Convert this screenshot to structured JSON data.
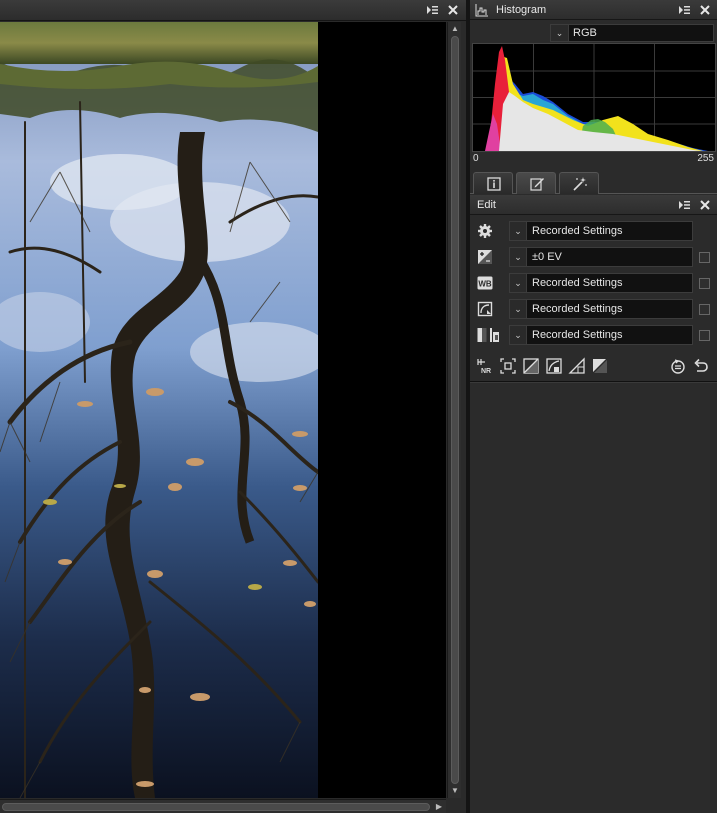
{
  "viewer": {
    "titlebar_icons": [
      "panel-menu-icon",
      "close-icon"
    ]
  },
  "histogram_panel": {
    "title": "Histogram",
    "channel_select": {
      "value": "RGB"
    },
    "axis": {
      "min": "0",
      "max": "255"
    }
  },
  "tabs": [
    {
      "icon": "info-icon",
      "active": false
    },
    {
      "icon": "edit-pencil-icon",
      "active": true
    },
    {
      "icon": "magic-wand-icon",
      "active": false
    }
  ],
  "edit_panel": {
    "title": "Edit",
    "rows": [
      {
        "icon": "gear-icon",
        "value": "Recorded Settings",
        "has_checkbox": false
      },
      {
        "icon": "exposure-icon",
        "value": "±0 EV",
        "has_checkbox": true
      },
      {
        "icon": "wb-icon",
        "icon_text": "WB",
        "value": "Recorded Settings",
        "has_checkbox": true
      },
      {
        "icon": "picture-control-icon",
        "value": "Recorded Settings",
        "has_checkbox": true
      },
      {
        "icon": "active-d-lighting-icon",
        "value": "Recorded Settings",
        "has_checkbox": true
      }
    ],
    "tools": [
      {
        "icon": "noise-reduction-icon",
        "text": "NR"
      },
      {
        "icon": "crop-icon"
      },
      {
        "icon": "levels-curves-icon"
      },
      {
        "icon": "color-adjust-icon"
      },
      {
        "icon": "straighten-icon"
      },
      {
        "icon": "tone-icon"
      },
      {
        "icon": "history-icon"
      },
      {
        "icon": "undo-icon"
      }
    ]
  },
  "colors": {
    "panel_bg": "#2b2b2b",
    "header_bg": "#333333",
    "field_bg": "#111111",
    "histogram_red": "#e8203a",
    "histogram_yellow": "#f2e21c",
    "histogram_blue": "#1a4cd8",
    "histogram_cyan": "#2aa6d4",
    "histogram_magenta": "#e040a0",
    "histogram_fill": "#e6e6e6"
  }
}
